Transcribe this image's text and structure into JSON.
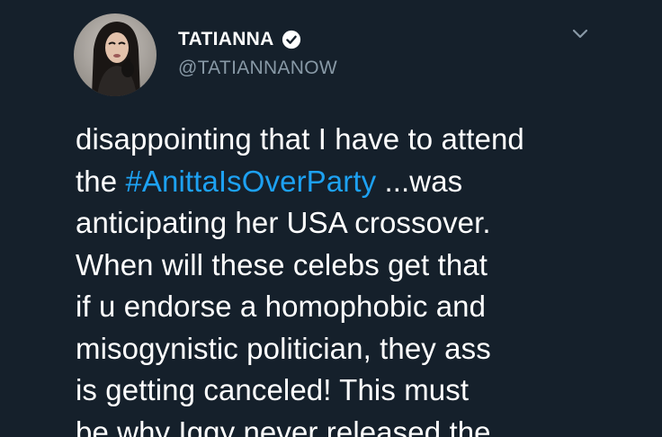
{
  "user": {
    "display_name": "TATIANNA",
    "handle": "@TATIANNANOW",
    "verified": true
  },
  "icons": {
    "avatar": "profile-photo",
    "verified": "verified-badge-icon",
    "menu": "chevron-down-icon"
  },
  "colors": {
    "background": "#15202b",
    "text": "#ffffff",
    "secondary": "#8899a6",
    "link": "#1da1f2"
  },
  "tweet": {
    "line1": "disappointing that I have to attend",
    "line2_pre": "the ",
    "hashtag": "#AnittaIsOverParty",
    "line2_post": " ...was",
    "line3": "anticipating her USA crossover.",
    "line4": "When will these celebs get that",
    "line5": "if u endorse a homophobic and",
    "line6": "misogynistic politician, they ass",
    "line7": "is getting canceled! This must",
    "line8": "be why Iggy never released the"
  }
}
